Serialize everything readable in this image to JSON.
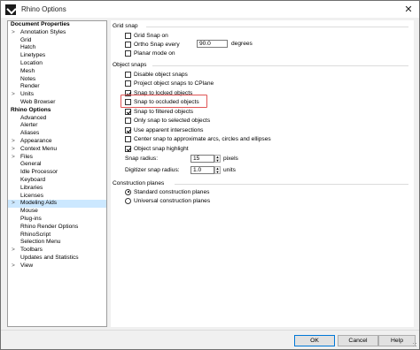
{
  "window": {
    "title": "Rhino Options",
    "close_glyph": "✕"
  },
  "tree": {
    "items": [
      {
        "label": "Document Properties",
        "kind": "group"
      },
      {
        "label": "Annotation Styles",
        "kind": "child",
        "expander": ">"
      },
      {
        "label": "Grid",
        "kind": "child"
      },
      {
        "label": "Hatch",
        "kind": "child"
      },
      {
        "label": "Linetypes",
        "kind": "child"
      },
      {
        "label": "Location",
        "kind": "child"
      },
      {
        "label": "Mesh",
        "kind": "child"
      },
      {
        "label": "Notes",
        "kind": "child"
      },
      {
        "label": "Render",
        "kind": "child"
      },
      {
        "label": "Units",
        "kind": "child",
        "expander": ">"
      },
      {
        "label": "Web Browser",
        "kind": "child"
      },
      {
        "label": "Rhino Options",
        "kind": "group"
      },
      {
        "label": "Advanced",
        "kind": "child"
      },
      {
        "label": "Alerter",
        "kind": "child"
      },
      {
        "label": "Aliases",
        "kind": "child"
      },
      {
        "label": "Appearance",
        "kind": "child",
        "expander": ">"
      },
      {
        "label": "Context Menu",
        "kind": "child",
        "expander": ">"
      },
      {
        "label": "Files",
        "kind": "child",
        "expander": ">"
      },
      {
        "label": "General",
        "kind": "child"
      },
      {
        "label": "Idle Processor",
        "kind": "child"
      },
      {
        "label": "Keyboard",
        "kind": "child"
      },
      {
        "label": "Libraries",
        "kind": "child"
      },
      {
        "label": "Licenses",
        "kind": "child"
      },
      {
        "label": "Modeling Aids",
        "kind": "child",
        "expander": ">",
        "selected": true
      },
      {
        "label": "Mouse",
        "kind": "child"
      },
      {
        "label": "Plug-ins",
        "kind": "child"
      },
      {
        "label": "Rhino Render Options",
        "kind": "child"
      },
      {
        "label": "RhinoScript",
        "kind": "child"
      },
      {
        "label": "Selection Menu",
        "kind": "child"
      },
      {
        "label": "Toolbars",
        "kind": "child",
        "expander": ">"
      },
      {
        "label": "Updates and Statistics",
        "kind": "child"
      },
      {
        "label": "View",
        "kind": "child",
        "expander": ">"
      }
    ]
  },
  "grid_snap": {
    "title": "Grid snap",
    "grid_snap_on": {
      "label": "Grid Snap on",
      "checked": false
    },
    "ortho_snap_every": {
      "label": "Ortho Snap every",
      "checked": false,
      "value": "90.0",
      "unit": "degrees"
    },
    "planar_mode_on": {
      "label": "Planar mode on",
      "checked": false
    }
  },
  "object_snaps": {
    "title": "Object snaps",
    "options": [
      {
        "label": "Disable object snaps",
        "checked": false
      },
      {
        "label": "Project object snaps to CPlane",
        "checked": false
      },
      {
        "label": "Snap to locked objects",
        "checked": true
      },
      {
        "label": "Snap to occluded objects",
        "checked": false
      },
      {
        "label": "Snap to filtered objects",
        "checked": true
      },
      {
        "label": "Only snap to selected objects",
        "checked": false
      },
      {
        "label": "Use apparent intersections",
        "checked": true
      },
      {
        "label": "Center snap to approximate arcs, circles and ellipses",
        "checked": false
      },
      {
        "label": "Object snap highlight",
        "checked": true
      }
    ],
    "snap_radius": {
      "label": "Snap radius:",
      "value": "15",
      "unit": "pixels"
    },
    "digitizer_snap_radius": {
      "label": "Digitizer snap radius:",
      "value": "1.0",
      "unit": "units"
    }
  },
  "construction_planes": {
    "title": "Construction planes",
    "options": [
      {
        "label": "Standard construction planes",
        "checked": true
      },
      {
        "label": "Universal construction planes",
        "checked": false
      }
    ]
  },
  "buttons": {
    "ok": "OK",
    "cancel": "Cancel",
    "help": "Help"
  },
  "colors": {
    "highlight_border": "#e05555",
    "selection": "#cce8ff"
  }
}
